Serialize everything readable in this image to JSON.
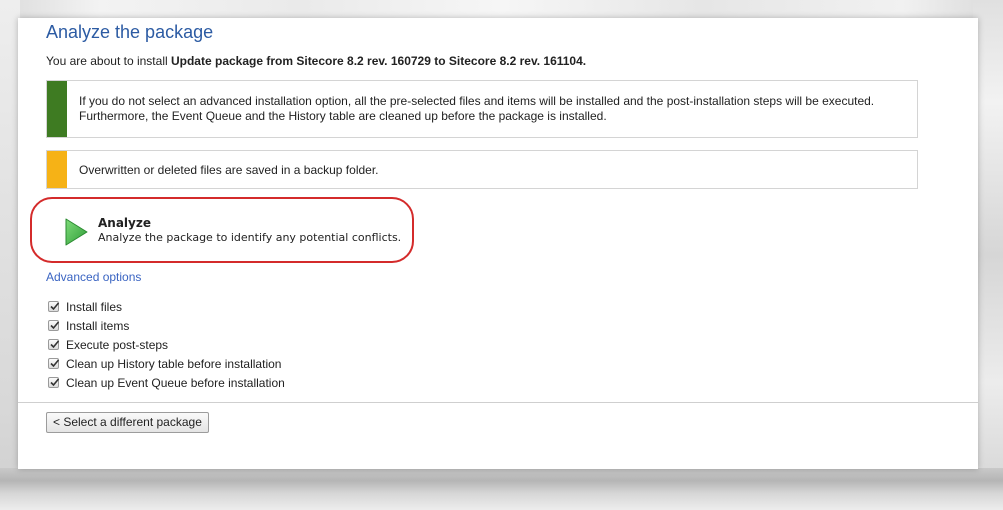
{
  "page": {
    "title": "Analyze the package",
    "intro_prefix": "You are about to install ",
    "intro_package": "Update package from Sitecore 8.2 rev. 160729 to Sitecore 8.2 rev. 161104."
  },
  "notices": [
    {
      "text": "If you do not select an advanced installation option, all the pre-selected files and items will be installed and the post-installation steps will be executed. Furthermore, the Event Queue and the History table are cleaned up before the package is installed.",
      "color": "#3e7b22"
    },
    {
      "text": "Overwritten or deleted files are saved in a backup folder.",
      "color": "#f6b216"
    }
  ],
  "analyze": {
    "label": "Analyze",
    "description": "Analyze the package to identify any potential conflicts.",
    "icon": "play-icon",
    "icon_color": "#43b84a",
    "highlight_color": "#d42b2b"
  },
  "advanced": {
    "link_label": "Advanced options",
    "options": [
      {
        "label": "Install files",
        "checked": true
      },
      {
        "label": "Install items",
        "checked": true
      },
      {
        "label": "Execute post-steps",
        "checked": true
      },
      {
        "label": "Clean up History table before installation",
        "checked": true
      },
      {
        "label": "Clean up Event Queue before installation",
        "checked": true
      }
    ]
  },
  "footer": {
    "back_button": "< Select a different package"
  },
  "colors": {
    "title": "#2c5ba3",
    "link": "#3a64c2"
  }
}
